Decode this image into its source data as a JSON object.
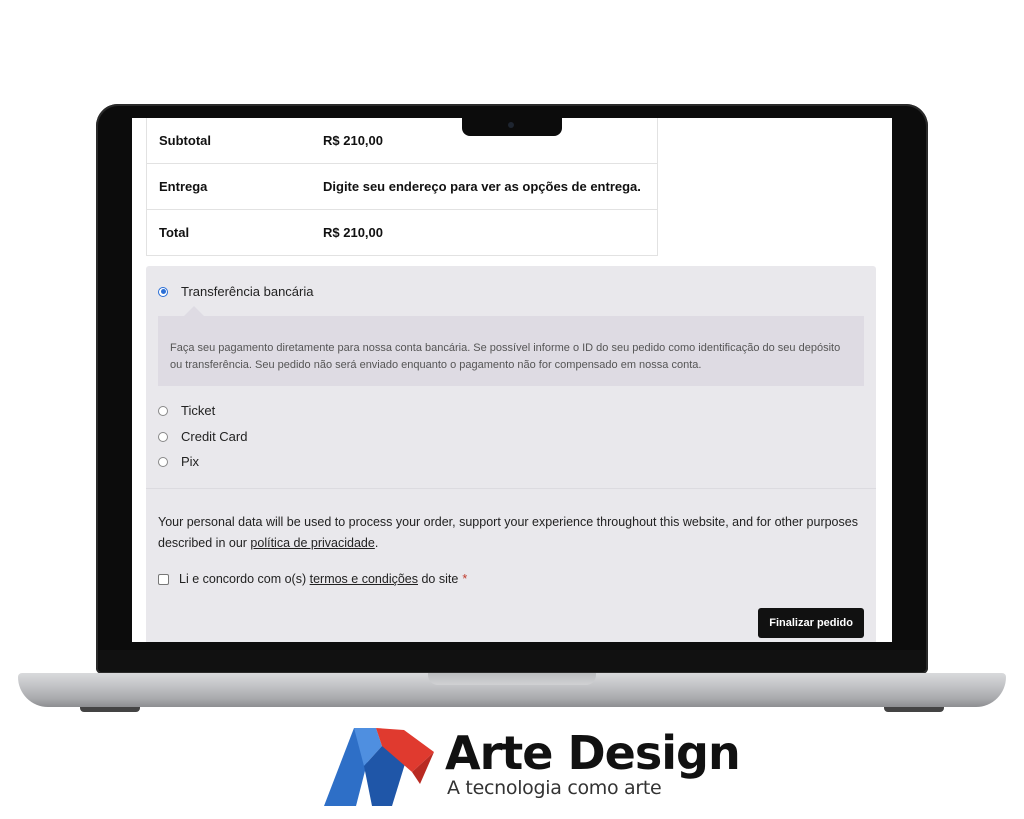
{
  "order_totals": {
    "rows": [
      {
        "label": "Subtotal",
        "value": "R$ 210,00"
      },
      {
        "label": "Entrega",
        "value": "Digite seu endereço para ver as opções de entrega."
      },
      {
        "label": "Total",
        "value": "R$ 210,00"
      }
    ]
  },
  "payment": {
    "methods": [
      {
        "label": "Transferência bancária",
        "selected": true
      },
      {
        "label": "Ticket",
        "selected": false
      },
      {
        "label": "Credit Card",
        "selected": false
      },
      {
        "label": "Pix",
        "selected": false
      }
    ],
    "selected_description": "Faça seu pagamento diretamente para nossa conta bancária. Se possível informe o ID do seu pedido como identificação do seu depósito ou transferência. Seu pedido não será enviado enquanto o pagamento não for compensado em nossa conta."
  },
  "privacy": {
    "text": "Your personal data will be used to process your order, support your experience throughout this website, and for other purposes described in our ",
    "link": "política de privacidade",
    "suffix": "."
  },
  "terms": {
    "prefix": "Li e concordo com o(s) ",
    "link": "termos e condições",
    "suffix": " do site",
    "required_mark": "*",
    "checked": false
  },
  "submit_label": "Finalizar pedido",
  "branding": {
    "title": "Arte Design",
    "tagline": "A tecnologia como arte",
    "colors": {
      "blue": "#2e6fc7",
      "red": "#e03a2f"
    }
  }
}
